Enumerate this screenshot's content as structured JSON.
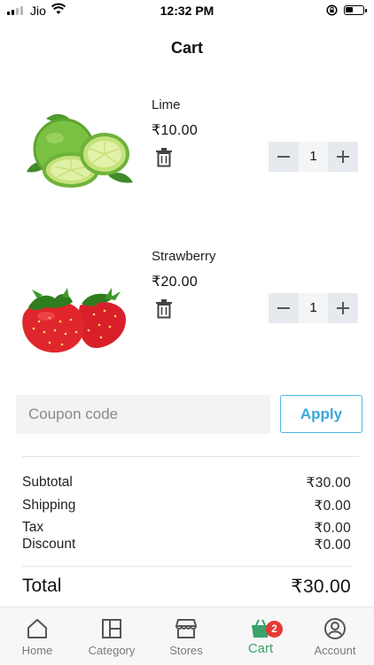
{
  "status_bar": {
    "carrier": "Jio",
    "time": "12:32 PM"
  },
  "header": {
    "title": "Cart"
  },
  "items": [
    {
      "name": "Lime",
      "price": "₹10.00",
      "quantity": "1",
      "image": "lime-fruit"
    },
    {
      "name": "Strawberry",
      "price": "₹20.00",
      "quantity": "1",
      "image": "strawberry-fruit"
    }
  ],
  "coupon": {
    "placeholder": "Coupon code",
    "value": "",
    "apply_label": "Apply"
  },
  "summary": {
    "subtotal_label": "Subtotal",
    "subtotal_value": "₹30.00",
    "shipping_label": "Shipping",
    "shipping_value": "₹0.00",
    "tax_label": "Tax",
    "tax_value": "₹0.00",
    "discount_label": "Discount",
    "discount_value": "₹0.00",
    "total_label": "Total",
    "total_value": "₹30.00"
  },
  "tabbar": {
    "items": [
      {
        "label": "Home",
        "icon": "home-icon"
      },
      {
        "label": "Category",
        "icon": "category-icon"
      },
      {
        "label": "Stores",
        "icon": "store-icon"
      },
      {
        "label": "Cart",
        "icon": "cart-icon",
        "badge": "2",
        "active": true
      },
      {
        "label": "Account",
        "icon": "account-icon"
      }
    ]
  },
  "colors": {
    "accent": "#3aa8da",
    "active_tab": "#3aa36d",
    "badge": "#e53935"
  }
}
